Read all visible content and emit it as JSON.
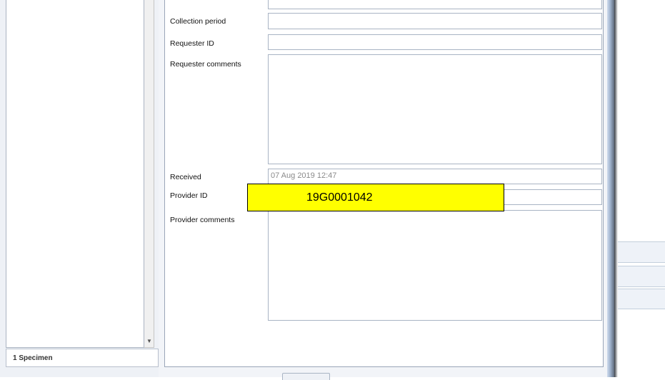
{
  "specimen_panel": {
    "count_label": "1 Specimen"
  },
  "form": {
    "collection_period": {
      "label": "Collection period",
      "value": ""
    },
    "requester_id": {
      "label": "Requester ID",
      "value": ""
    },
    "requester_comments": {
      "label": "Requester comments",
      "value": ""
    },
    "received": {
      "label": "Received",
      "value": "07 Aug 2019 12:47"
    },
    "provider_id": {
      "label": "Provider ID",
      "value": "",
      "overlay_value": "19G0001042"
    },
    "provider_comments": {
      "label": "Provider comments",
      "value": ""
    }
  },
  "icons": {
    "scroll_down": "chevron-down-icon"
  },
  "colors": {
    "overlay_fill": "#ffff00",
    "field_border": "#a9b4c4",
    "window_edge": "#9fb2cc"
  }
}
